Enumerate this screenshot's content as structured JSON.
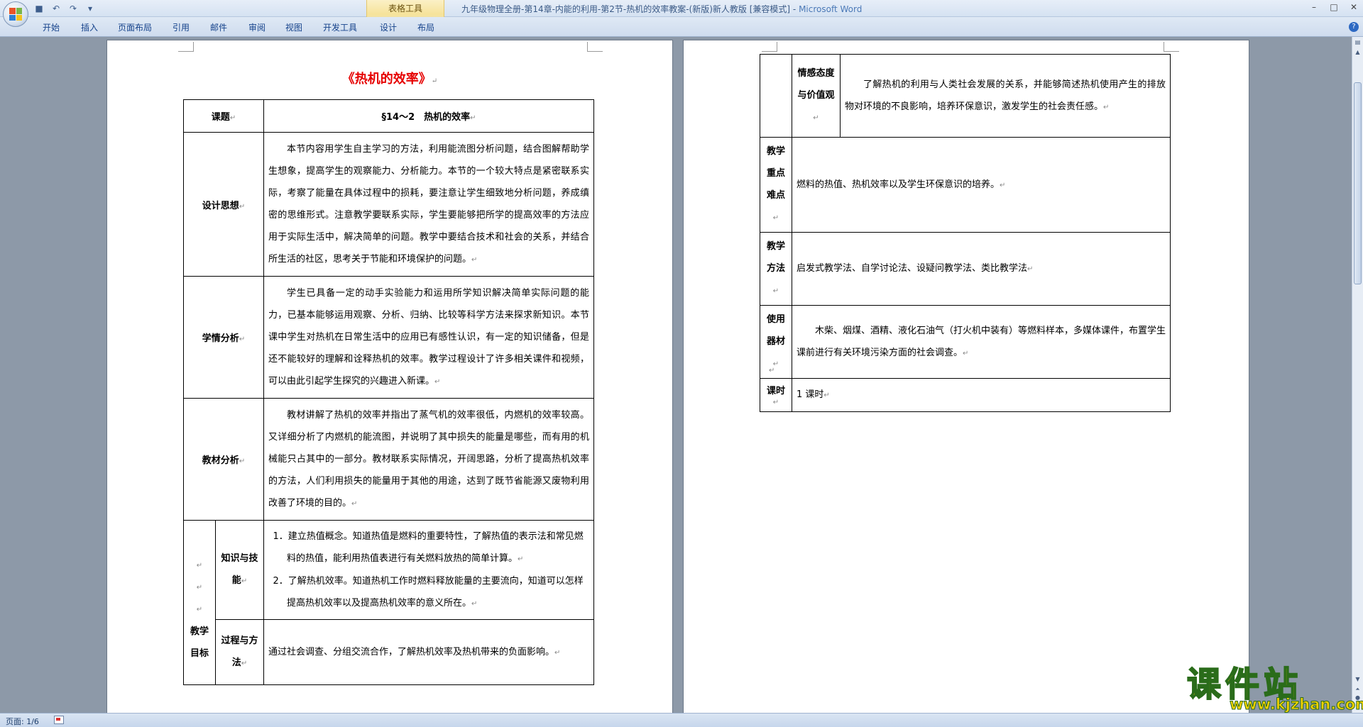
{
  "window": {
    "title_doc": "九年级物理全册-第14章-内能的利用-第2节-热机的效率教案-(新版)新人教版 [兼容模式] - ",
    "title_app": "Microsoft Word"
  },
  "contextual_group": "表格工具",
  "ribbon_tabs": [
    "开始",
    "插入",
    "页面布局",
    "引用",
    "邮件",
    "审阅",
    "视图",
    "开发工具",
    "设计",
    "布局"
  ],
  "document": {
    "title": "《热机的效率》",
    "page1": {
      "topic_label": "课题",
      "topic_value": "§14～2　热机的效率",
      "design_label": "设计思想",
      "design_text": "本节内容用学生自主学习的方法，利用能流图分析问题，结合图解帮助学生想象，提高学生的观察能力、分析能力。本节的一个较大特点是紧密联系实际，考察了能量在具体过程中的损耗，要注意让学生细致地分析问题，养成缜密的思维形式。注意教学要联系实际，学生要能够把所学的提高效率的方法应用于实际生活中，解决简单的问题。教学中要结合技术和社会的关系，并结合所生活的社区，思考关于节能和环境保护的问题。",
      "student_label": "学情分析",
      "student_text": "学生已具备一定的动手实验能力和运用所学知识解决简单实际问题的能力，已基本能够运用观察、分析、归纳、比较等科学方法来探求新知识。本节课中学生对热机在日常生活中的应用已有感性认识，有一定的知识储备，但是还不能较好的理解和诠释热机的效率。教学过程设计了许多相关课件和视频，可以由此引起学生探究的兴趣进入新课。",
      "material_label": "教材分析",
      "material_text": "教材讲解了热机的效率并指出了蒸气机的效率很低，内燃机的效率较高。又详细分析了内燃机的能流图，并说明了其中损失的能量是哪些，而有用的机械能只占其中的一部分。教材联系实际情况，开阔思路，分析了提高热机效率的方法，人们利用损失的能量用于其他的用途，达到了既节省能源又废物利用改善了环境的目的。",
      "goal_label": "教学目标",
      "knowledge_label": "知识与技能",
      "knowledge_items": [
        "1．建立热值概念。知道热值是燃料的重要特性，了解热值的表示法和常见燃料的热值，能利用热值表进行有关燃料放热的简单计算。",
        "2．了解热机效率。知道热机工作时燃料释放能量的主要流向，知道可以怎样提高热机效率以及提高热机效率的意义所在。"
      ],
      "process_label": "过程与方法",
      "process_text": "通过社会调查、分组交流合作，了解热机效率及热机带来的负面影响。"
    },
    "page2": {
      "emotion_label": "情感态度与价值观",
      "emotion_text": "了解热机的利用与人类社会发展的关系，并能够简述热机使用产生的排放物对环境的不良影响，培养环保意识，激发学生的社会责任感。",
      "key_label": "教学重点难点",
      "key_text": "燃料的热值、热机效率以及学生环保意识的培养。",
      "method_label": "教学方法",
      "method_text": "启发式教学法、自学讨论法、设疑问教学法、类比教学法",
      "equip_label": "使用器材",
      "equip_text": "木柴、烟煤、酒精、液化石油气（打火机中装有）等燃料样本，多媒体课件，布置学生课前进行有关环境污染方面的社会调查。",
      "hours_label": "课时",
      "hours_text": "1 课时"
    }
  },
  "status": {
    "page": "页面: 1/6"
  },
  "watermark": {
    "title": "课件站",
    "url": "www.kjzhan.com"
  },
  "colors": {
    "title_red": "#e60000",
    "ribbon_text": "#15428b",
    "watermark_yellow": "#f6d200",
    "watermark_green": "#2a6c1a"
  }
}
